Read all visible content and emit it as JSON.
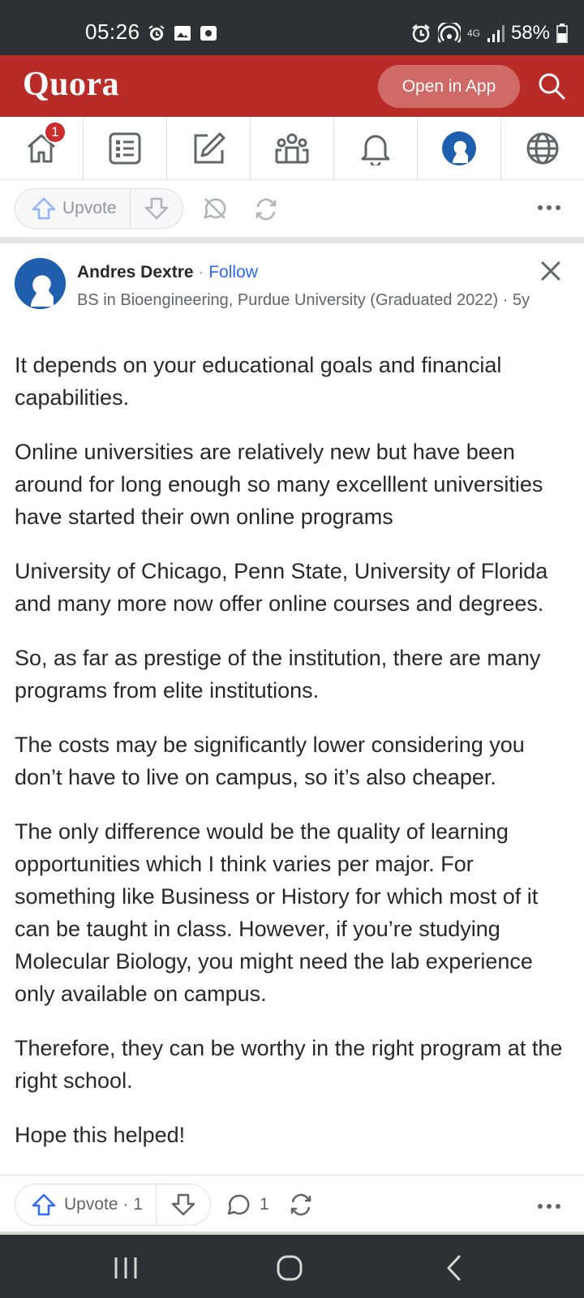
{
  "status_bar": {
    "time": "05:26",
    "battery": "58%",
    "network": "4G"
  },
  "header": {
    "logo": "Quora",
    "open_in_app": "Open in App"
  },
  "nav": {
    "home_badge": "1",
    "tabs": [
      "home-icon",
      "list-icon",
      "edit-icon",
      "spaces-icon",
      "bell-icon",
      "profile-icon",
      "globe-icon"
    ]
  },
  "top_actions": {
    "upvote_label": "Upvote"
  },
  "answer": {
    "author": "Andres Dextre",
    "follow": "Follow",
    "separator": " · ",
    "credential": "BS in Bioengineering, Purdue University (Graduated 2022) · 5y",
    "paragraphs": [
      "It depends on your educational goals and financial capabilities.",
      "Online universities are relatively new but have been around for long enough so many excelllent universities have started their own online programs",
      "University of Chicago, Penn State, University of Florida and many more now offer online courses and degrees.",
      "So, as far as prestige of the institution, there are many programs from elite institutions.",
      "The costs may be significantly lower considering you don’t have to live on campus, so it’s also cheaper.",
      "The only difference would be the quality of learning opportunities which I think varies per major. For something like Business or History for which most of it can be taught in class. However, if you’re studying Molecular Biology, you might need the lab experience only available on campus.",
      "Therefore, they can be worthy in the right program at the right school.",
      "Hope this helped!"
    ]
  },
  "bottom_actions": {
    "upvote_label": "Upvote · 1",
    "comment_count": "1"
  },
  "colors": {
    "brand_red": "#b92b27",
    "link_blue": "#2e69ff",
    "dark_bar": "#2f3033"
  }
}
